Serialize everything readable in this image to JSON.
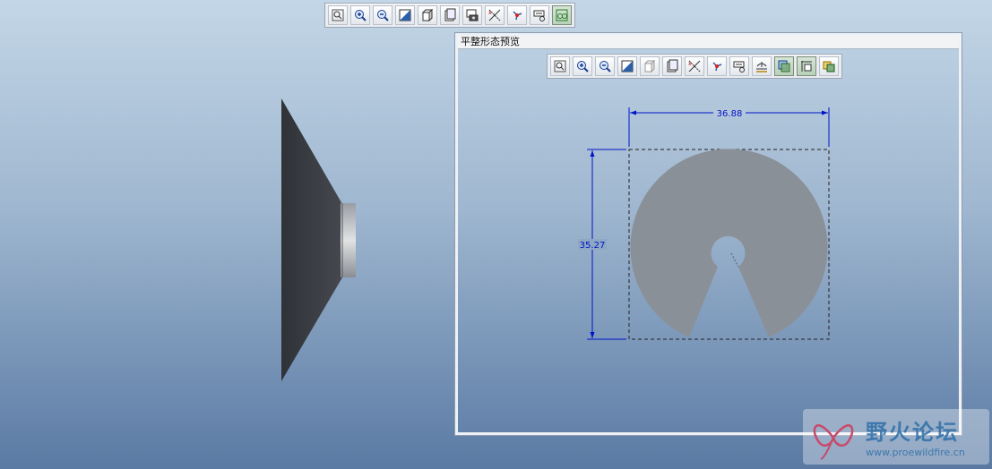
{
  "main_toolbar": {
    "buttons": [
      "refit-icon",
      "zoom-in-icon",
      "zoom-out-icon",
      "reorient-icon",
      "display-style-icon",
      "saved-views-icon",
      "layers-icon",
      "datum-display-icon",
      "spin-center-icon",
      "annotation-display-icon",
      "appearance-icon"
    ]
  },
  "preview": {
    "title": "平整形态预览",
    "toolbar_buttons": [
      "refit-icon",
      "zoom-in-icon",
      "zoom-out-icon",
      "reorient-icon",
      "display-style-icon",
      "saved-views-icon",
      "datum-display-icon",
      "spin-center-icon",
      "annotation-display-icon",
      "flat-state-icon",
      "overlay-icon",
      "dimension-display-icon",
      "appearance-icon"
    ],
    "dimensions": {
      "width": "36.88",
      "height": "35.27"
    }
  },
  "watermark": {
    "title": "野火论坛",
    "url": "www.proewildfire.cn"
  },
  "colors": {
    "part_dark": "#3b3e43",
    "flat_pattern": "#8a9098",
    "dimension": "#0015c8"
  }
}
